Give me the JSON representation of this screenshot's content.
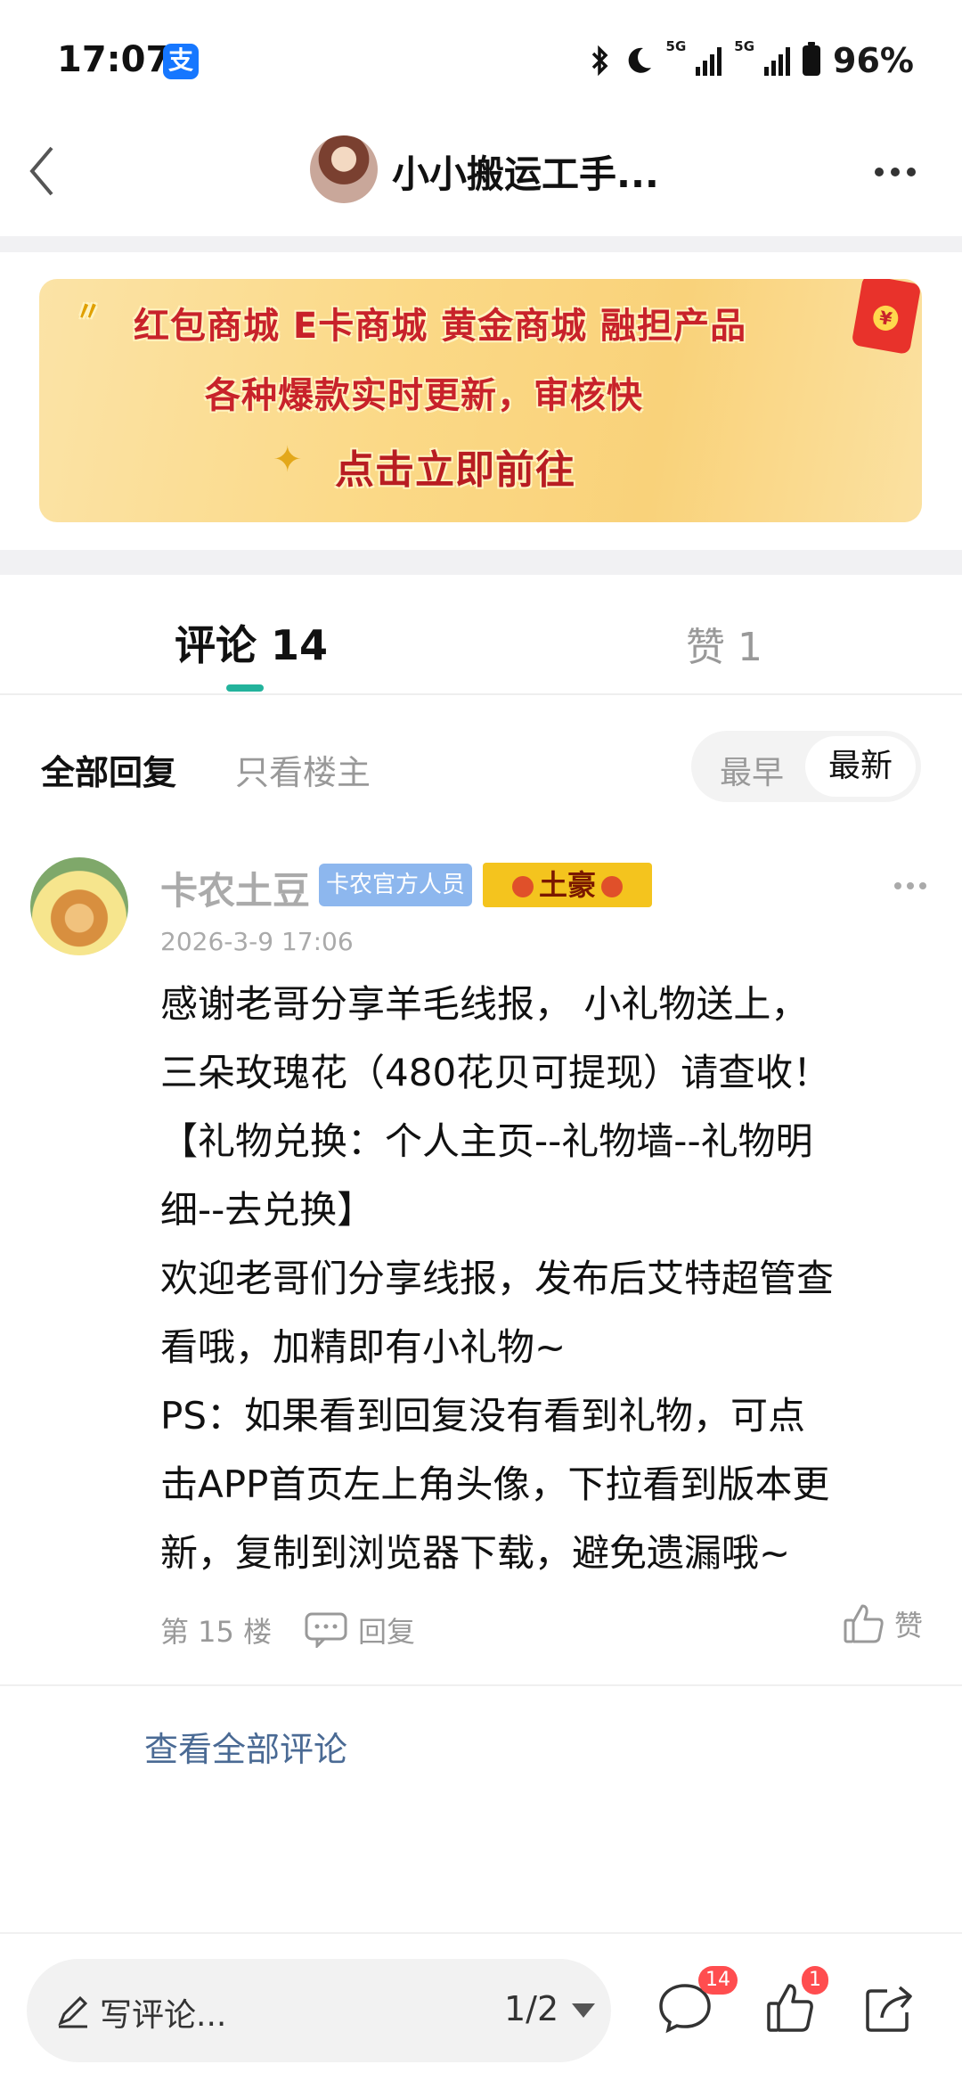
{
  "status_bar": {
    "time": "17:07",
    "app_icon": "alipay-icon",
    "battery": "96%",
    "net_tag_1": "5G",
    "net_tag_2": "5G",
    "icons": [
      "bluetooth-icon",
      "moon-icon",
      "signal-icon",
      "signal-icon",
      "battery-icon"
    ]
  },
  "header": {
    "title": "小小搬运工手...",
    "back_icon": "back-chevron-icon",
    "more_icon": "more-dots-icon"
  },
  "banner": {
    "line1": "红包商城   E卡商城   黄金商城   融担产品",
    "line2": "各种爆款实时更新，审核快",
    "line3": "点击立即前往",
    "sparkle": "✦"
  },
  "tabs": {
    "comments": "评论 14",
    "likes": "赞 1",
    "active": "comments",
    "accent": "#23b39c"
  },
  "filters": {
    "all": "全部回复",
    "op_only": "只看楼主",
    "sort_earliest": "最早",
    "sort_latest": "最新",
    "sort_active": "最新"
  },
  "comment": {
    "username": "卡农土豆",
    "badge": "卡农官方人员",
    "rank": "土豪",
    "timestamp": "2026-3-9 17:06",
    "lines": [
      "感谢老哥分享羊毛线报， 小礼物送上，",
      "三朵玫瑰花（480花贝可提现）请查收！",
      "【礼物兑换：个人主页--礼物墙--礼物明",
      "细--去兑换】",
      "欢迎老哥们分享线报，发布后艾特超管查",
      "看哦，加精即有小礼物~",
      "PS：如果看到回复没有看到礼物，可点",
      "击APP首页左上角头像，下拉看到版本更",
      "新，复制到浏览器下载，避免遗漏哦~"
    ],
    "floor": "第 15 楼",
    "reply": "回复",
    "like": "赞"
  },
  "view_all": "查看全部评论",
  "bottom_bar": {
    "write_placeholder": "写评论...",
    "page": "1/2",
    "comment_count": "14",
    "like_count": "1",
    "badge_color": "#ff4d4f"
  }
}
